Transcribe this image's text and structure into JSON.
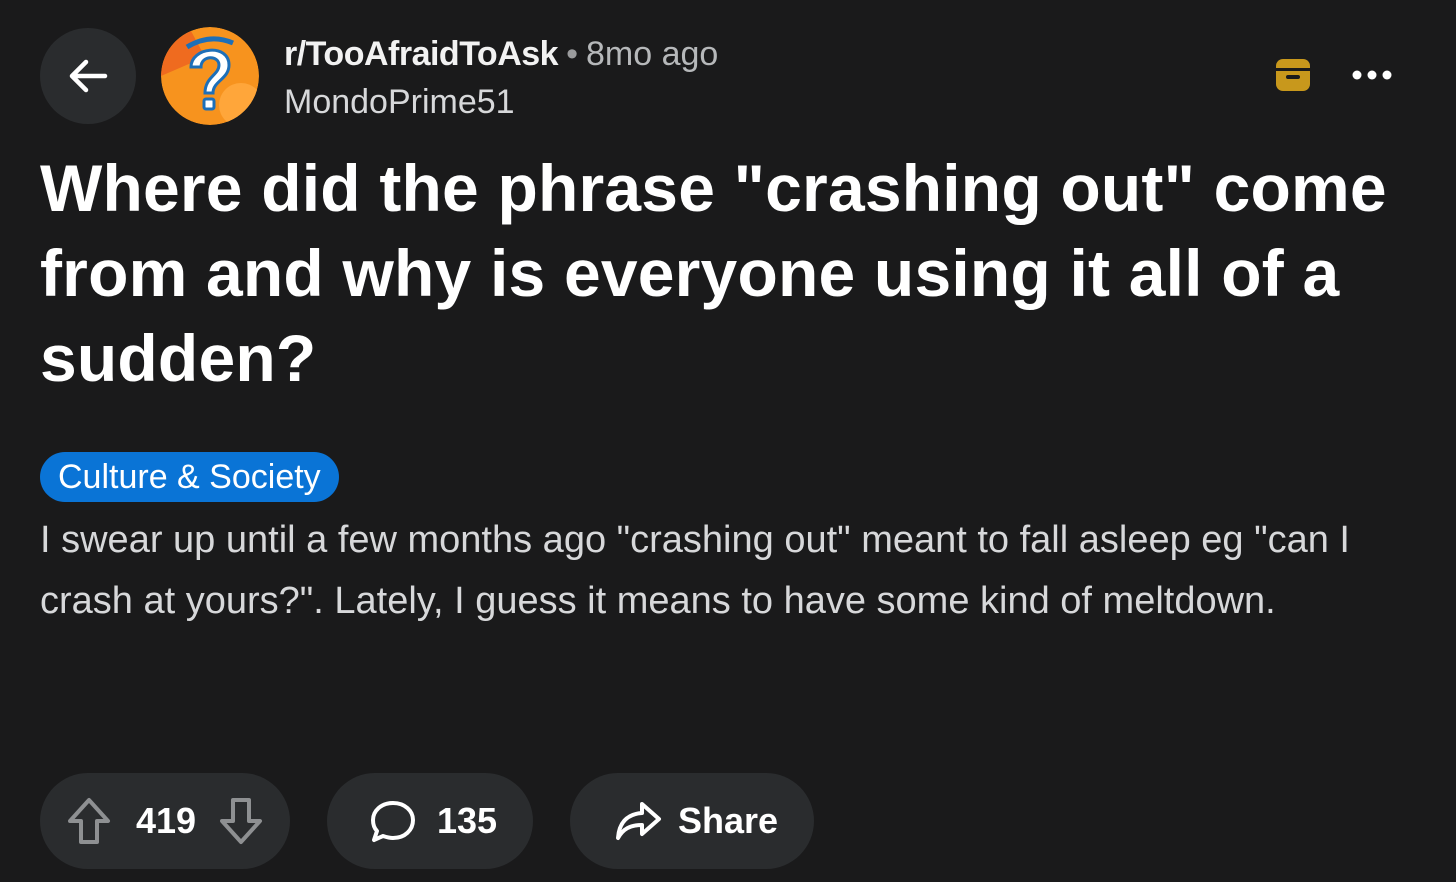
{
  "post": {
    "subreddit": "r/TooAfraidToAsk",
    "separator": "•",
    "time_ago": "8mo ago",
    "author": "MondoPrime51",
    "title": "Where did the phrase \"crashing out\" come from and why is everyone using it all of a sudden?",
    "flair": "Culture & Society",
    "body": "I swear up until a few months ago \"crashing out\" meant to fall asleep eg \"can I crash at yours?\". Lately, I guess it means to have some kind of meltdown."
  },
  "actions": {
    "vote_count": "419",
    "comment_count": "135",
    "share_label": "Share"
  },
  "icons": {
    "back": "arrow-left-icon",
    "archive": "archive-icon",
    "more": "more-dots-icon",
    "upvote": "upvote-arrow-icon",
    "downvote": "downvote-arrow-icon",
    "comment": "comment-bubble-icon",
    "share": "share-arrow-icon"
  },
  "colors": {
    "background": "#1a1a1b",
    "pill_background": "#2a2c2e",
    "flair_blue": "#0a74d6",
    "archive_gold": "#c8981c",
    "avatar_orange": "#f7931e"
  }
}
